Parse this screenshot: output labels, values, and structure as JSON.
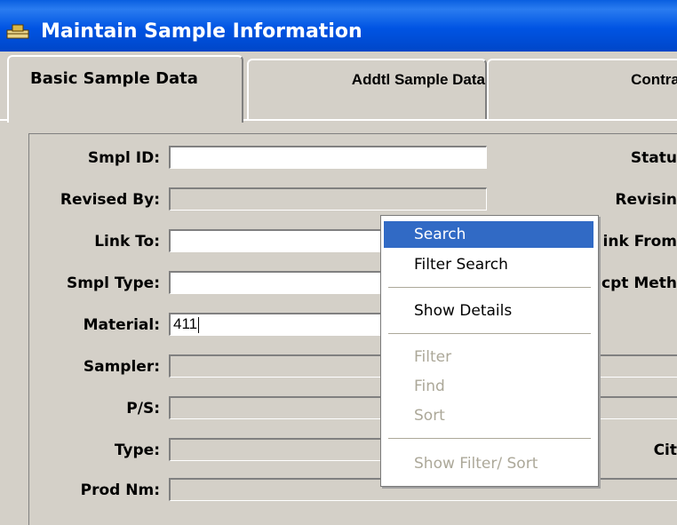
{
  "window": {
    "title": "Maintain Sample Information",
    "icon": "sample-app-icon"
  },
  "tabs": [
    {
      "label": "Basic Sample Data",
      "active": true
    },
    {
      "label": "Addtl Sample Data",
      "active": false
    },
    {
      "label": "Contract",
      "active": false
    }
  ],
  "form": {
    "left": [
      {
        "label": "Smpl ID:",
        "value": ""
      },
      {
        "label": "Revised By:",
        "value": ""
      },
      {
        "label": "Link To:",
        "value": ""
      },
      {
        "label": "Smpl Type:",
        "value": ""
      },
      {
        "label": "Material:",
        "value": "411"
      },
      {
        "label": "Sampler:",
        "value": ""
      },
      {
        "label": "P/S:",
        "value": ""
      },
      {
        "label": "Type:",
        "value": ""
      },
      {
        "label": "Prod Nm:",
        "value": ""
      }
    ],
    "right": [
      {
        "label": "Statu"
      },
      {
        "label": "Revisin"
      },
      {
        "label": "ink From"
      },
      {
        "label": "cpt Meth"
      },
      {
        "label": "Cit"
      }
    ]
  },
  "context_menu": {
    "items": [
      {
        "label": "Search",
        "state": "highlighted"
      },
      {
        "label": "Filter Search",
        "state": "enabled"
      },
      {
        "label": "Show Details",
        "state": "enabled"
      },
      {
        "label": "Filter",
        "state": "disabled"
      },
      {
        "label": "Find",
        "state": "disabled"
      },
      {
        "label": "Sort",
        "state": "disabled"
      },
      {
        "label": "Show Filter/ Sort",
        "state": "disabled"
      }
    ]
  },
  "colors": {
    "titlebar": "#0054e3",
    "highlight": "#316ac5",
    "face": "#d4d0c8",
    "disabled": "#aca899"
  }
}
